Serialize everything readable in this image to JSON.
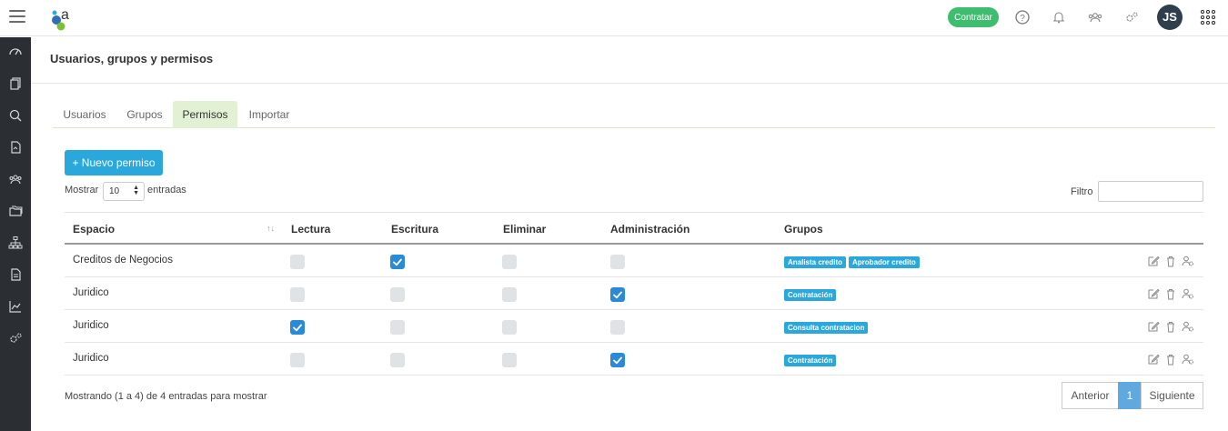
{
  "header": {
    "contratar_label": "Contratar",
    "avatar_initials": "JS",
    "icons": [
      "help-icon",
      "bell-icon",
      "users-icon",
      "settings-icon",
      "apps-grid-icon"
    ]
  },
  "sidebar": {
    "items": [
      "dashboard-icon",
      "documents-icon",
      "search-icon",
      "file-icon",
      "users-icon",
      "folders-icon",
      "hierarchy-icon",
      "report-icon",
      "chart-icon",
      "settings-icon"
    ]
  },
  "page": {
    "title": "Usuarios, grupos y permisos"
  },
  "tabs": [
    {
      "label": "Usuarios",
      "active": false
    },
    {
      "label": "Grupos",
      "active": false
    },
    {
      "label": "Permisos",
      "active": true
    },
    {
      "label": "Importar",
      "active": false
    }
  ],
  "toolbar": {
    "new_button_label": "+ Nuevo permiso",
    "show_label": "Mostrar",
    "length_value": "10",
    "entries_label": "entradas",
    "filter_label": "Filtro",
    "filter_value": ""
  },
  "table": {
    "columns": [
      "Espacio",
      "Lectura",
      "Escritura",
      "Eliminar",
      "Administración",
      "Grupos"
    ],
    "rows": [
      {
        "espacio": "Creditos de Negocios",
        "lectura": false,
        "escritura": true,
        "eliminar": false,
        "administracion": false,
        "grupos": [
          "Analista credito",
          "Aprobador credito"
        ]
      },
      {
        "espacio": "Juridico",
        "lectura": false,
        "escritura": false,
        "eliminar": false,
        "administracion": true,
        "grupos": [
          "Contratación"
        ]
      },
      {
        "espacio": "Juridico",
        "lectura": true,
        "escritura": false,
        "eliminar": false,
        "administracion": false,
        "grupos": [
          "Consulta contratacion"
        ]
      },
      {
        "espacio": "Juridico",
        "lectura": false,
        "escritura": false,
        "eliminar": false,
        "administracion": true,
        "grupos": [
          "Contratación"
        ]
      }
    ]
  },
  "footer": {
    "info": "Mostrando (1 a 4) de 4 entradas para mostrar",
    "prev_label": "Anterior",
    "current_page": "1",
    "next_label": "Siguiente"
  },
  "colors": {
    "accent": "#2aa8dc",
    "contratar": "#3ebd6e",
    "checkbox_checked": "#2b8ad6",
    "active_tab": "#e2f0d4",
    "sidebar": "#2b2f33"
  }
}
